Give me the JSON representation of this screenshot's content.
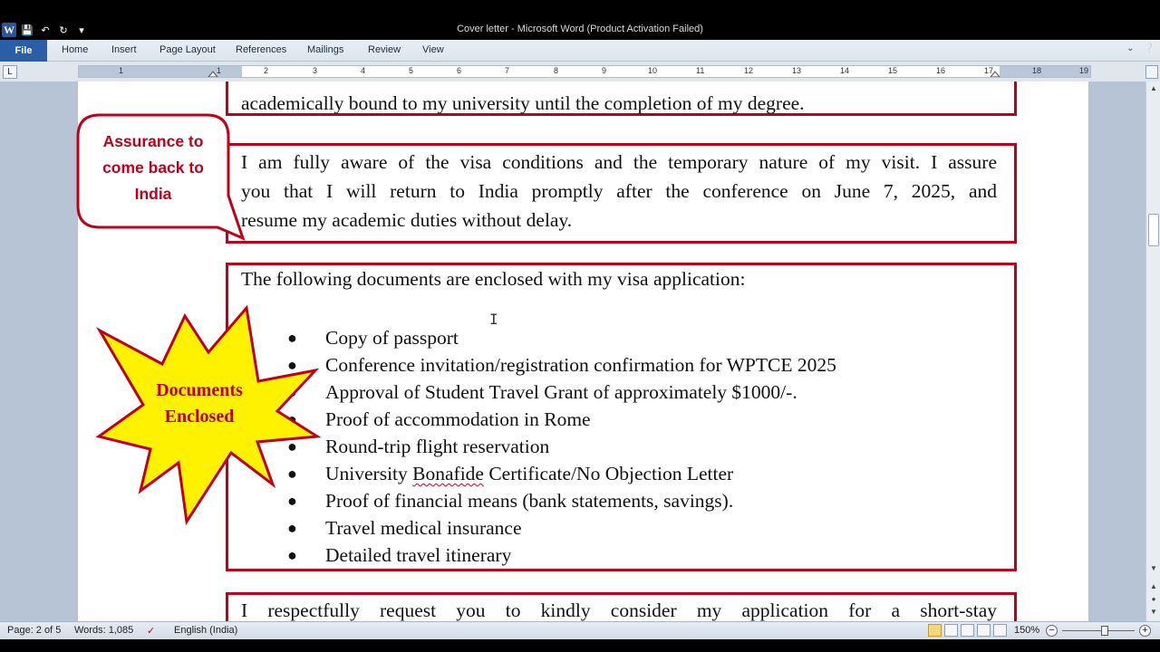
{
  "window": {
    "title": "Cover letter  -  Microsoft Word (Product Activation Failed)"
  },
  "ribbon": {
    "file_label": "File",
    "tabs": [
      "Home",
      "Insert",
      "Page Layout",
      "References",
      "Mailings",
      "Review",
      "View"
    ]
  },
  "ruler": {
    "numbers": [
      "1",
      "1",
      "2",
      "3",
      "4",
      "5",
      "6",
      "7",
      "8",
      "9",
      "10",
      "11",
      "12",
      "13",
      "14",
      "15",
      "16",
      "17",
      "18",
      "19"
    ]
  },
  "document": {
    "top_line": "academically bound to my university until the completion of my degree.",
    "assurance_paragraph": {
      "lines": [
        "I am fully aware of the visa conditions and the temporary nature of my visit. I assure",
        "you that I will return to India promptly after the conference on June 7, 2025, and",
        "resume my academic duties without delay."
      ]
    },
    "documents_intro": "The following documents are enclosed with my visa application:",
    "documents": [
      {
        "text": "Copy of passport"
      },
      {
        "text": "Conference invitation/registration confirmation for WPTCE 2025"
      },
      {
        "text": "Approval of Student Travel Grant of approximately $1000/-."
      },
      {
        "text": "Proof of accommodation in Rome"
      },
      {
        "text": "Round-trip flight reservation"
      },
      {
        "pre": "University ",
        "spell": "Bonafide",
        "post": " Certificate/No Objection Letter"
      },
      {
        "text": "Proof of financial means (bank statements, savings)."
      },
      {
        "text": "Travel medical insurance"
      },
      {
        "text": "Detailed travel itinerary"
      }
    ],
    "bottom_line": "I respectfully request you to kindly consider my application for a short-stay"
  },
  "annotations": {
    "callout_lines": [
      "Assurance to",
      "come back to",
      "India"
    ],
    "star_lines": [
      "Documents",
      "Enclosed"
    ]
  },
  "status": {
    "page": "Page: 2 of 5",
    "words": "Words: 1,085",
    "language": "English (India)",
    "zoom": "150%"
  },
  "colors": {
    "accent_red": "#c00018",
    "star_fill": "#fff200",
    "word_blue": "#2a5fa8"
  }
}
